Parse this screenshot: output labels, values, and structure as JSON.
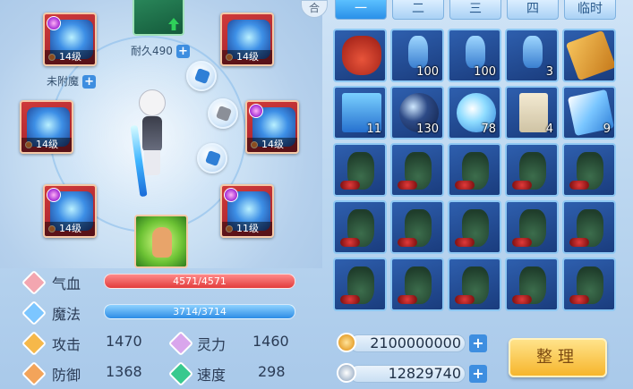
{
  "equipment": {
    "durability_label": "耐久490",
    "unenchanted_label": "未附魔",
    "plus_symbol": "+",
    "slots": [
      {
        "level": "14级"
      },
      {
        "level": "14级"
      },
      {
        "level": "14级"
      },
      {
        "level": "14级"
      },
      {
        "level": "14级"
      },
      {
        "level": "11级"
      }
    ]
  },
  "stats": {
    "hp": {
      "label": "气血",
      "value": "4571/4571",
      "fill": 1.0
    },
    "mp": {
      "label": "魔法",
      "value": "3714/3714",
      "fill": 1.0
    },
    "attack": {
      "label": "攻击",
      "value": "1470"
    },
    "spirit": {
      "label": "灵力",
      "value": "1460"
    },
    "defense": {
      "label": "防御",
      "value": "1368"
    },
    "speed": {
      "label": "速度",
      "value": "298"
    }
  },
  "inventory": {
    "sort_top_label": "合",
    "tabs": [
      "一",
      "二",
      "三",
      "四",
      "临时"
    ],
    "active_tab": 0,
    "row1": [
      {
        "item": "red-bag-icon",
        "count": ""
      },
      {
        "item": "blue-vase-icon",
        "count": "100"
      },
      {
        "item": "blue-vase-icon",
        "count": "100"
      },
      {
        "item": "blue-vase-icon",
        "count": "3"
      },
      {
        "item": "gold-box-icon",
        "count": ""
      }
    ],
    "row2": [
      {
        "item": "blue-book-icon",
        "count": "11"
      },
      {
        "item": "dark-orb-icon",
        "count": "130"
      },
      {
        "item": "blue-orb-icon",
        "count": "78"
      },
      {
        "item": "scroll-icon",
        "count": "4"
      },
      {
        "item": "magic-card-icon",
        "count": "9"
      }
    ]
  },
  "currency": {
    "gold": "2100000000",
    "silver": "12829740",
    "plus_symbol": "+"
  },
  "tidy_button": "整理"
}
